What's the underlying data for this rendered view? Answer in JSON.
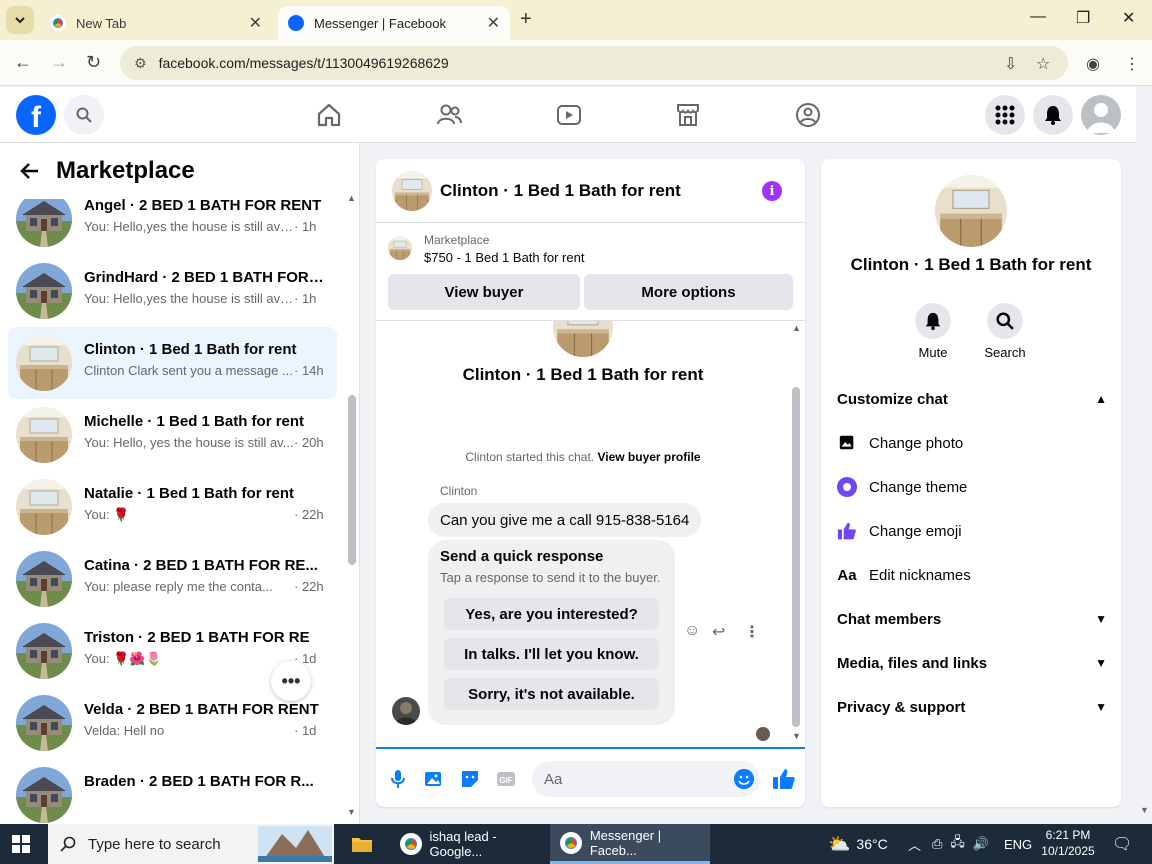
{
  "browser": {
    "tabs": [
      {
        "title": "New Tab",
        "active": false
      },
      {
        "title": "Messenger | Facebook",
        "active": true
      }
    ],
    "url": "facebook.com/messages/t/1130049619268629"
  },
  "sidebar": {
    "title": "Marketplace",
    "conversations": [
      {
        "name": "Angel · 2 BED 1 BATH FOR RENT",
        "snippet": "You: Hello,yes the house is still avail...",
        "time": "· 1h",
        "thumb": "house"
      },
      {
        "name": "GrindHard · 2 BED 1 BATH FOR R...",
        "snippet": "You: Hello,yes the house is still avail...",
        "time": "· 1h",
        "thumb": "house"
      },
      {
        "name": "Clinton · 1 Bed 1 Bath for rent",
        "snippet": "Clinton Clark sent you a message ...",
        "time": "· 14h",
        "thumb": "kitchen",
        "active": true
      },
      {
        "name": "Michelle · 1 Bed 1 Bath for rent",
        "snippet": "You: Hello, yes the house is still av...",
        "time": "· 20h",
        "thumb": "kitchen"
      },
      {
        "name": "Natalie · 1 Bed 1 Bath for rent",
        "snippet": "You: 🌹",
        "time": "· 22h",
        "thumb": "kitchen"
      },
      {
        "name": "Catina · 2 BED 1 BATH FOR RE...",
        "snippet": "You: please reply me the conta...",
        "time": "· 22h",
        "thumb": "house"
      },
      {
        "name": "Triston · 2 BED 1 BATH FOR RE",
        "snippet": "You: 🌹🌺🌷",
        "time": "· 1d",
        "thumb": "house"
      },
      {
        "name": "Velda · 2 BED 1 BATH FOR RENT",
        "snippet": "Velda: Hell no",
        "time": "· 1d",
        "thumb": "house"
      },
      {
        "name": "Braden · 2 BED 1 BATH FOR R...",
        "snippet": "",
        "time": "",
        "thumb": "house"
      }
    ]
  },
  "chat": {
    "title": "Clinton · 1 Bed 1 Bath for rent",
    "marketplace_label": "Marketplace",
    "listing": "$750 - 1 Bed 1 Bath for rent",
    "view_buyer": "View buyer",
    "more_options": "More options",
    "started_text": "Clinton started this chat.",
    "view_buyer_profile": "View buyer profile",
    "sender": "Clinton",
    "message": "Can you give me a call 915-838-5164",
    "quick": {
      "title": "Send a quick response",
      "subtitle": "Tap a response to send it to the buyer.",
      "options": [
        "Yes, are you interested?",
        "In talks. I'll let you know.",
        "Sorry, it's not available."
      ]
    },
    "composer_placeholder": "Aa"
  },
  "info_panel": {
    "title": "Clinton · 1 Bed 1 Bath for rent",
    "mute": "Mute",
    "search": "Search",
    "customize": "Customize chat",
    "items": [
      "Change photo",
      "Change theme",
      "Change emoji",
      "Edit nicknames"
    ],
    "sections": [
      "Chat members",
      "Media, files and links",
      "Privacy & support"
    ]
  },
  "taskbar": {
    "search_placeholder": "Type here to search",
    "apps": [
      "ishaq lead - Google...",
      "Messenger | Faceb..."
    ],
    "weather": "36°C",
    "lang": "ENG",
    "time": "6:21 PM",
    "date": "10/1/2025"
  },
  "colors": {
    "fb_blue": "#0866ff",
    "messenger_blue": "#0a7cff",
    "info_purple": "#a033ff"
  }
}
